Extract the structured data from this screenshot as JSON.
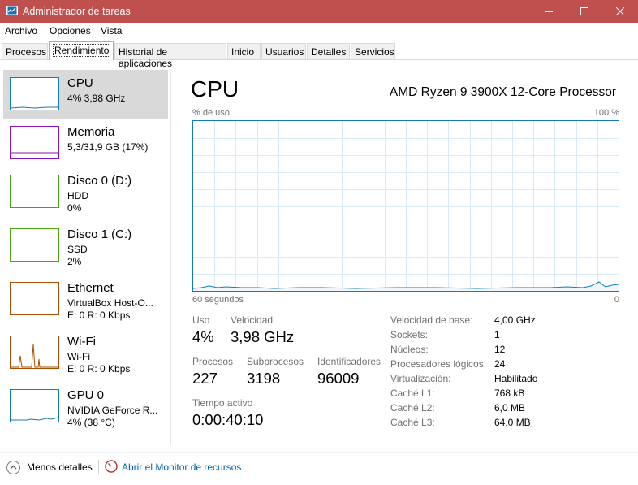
{
  "window": {
    "title": "Administrador de tareas"
  },
  "menu": [
    "Archivo",
    "Opciones",
    "Vista"
  ],
  "tabs": [
    "Procesos",
    "Rendimiento",
    "Historial de aplicaciones",
    "Inicio",
    "Usuarios",
    "Detalles",
    "Servicios"
  ],
  "resources": [
    {
      "name": "CPU",
      "line2": "4% 3,98 GHz",
      "line3": "",
      "color": "#117dbb"
    },
    {
      "name": "Memoria",
      "line2": "5,3/31,9 GB (17%)",
      "line3": "",
      "color": "#8b12ae"
    },
    {
      "name": "Disco 0 (D:)",
      "line2": "HDD",
      "line3": "0%",
      "color": "#4da60c"
    },
    {
      "name": "Disco 1 (C:)",
      "line2": "SSD",
      "line3": "2%",
      "color": "#4da60c"
    },
    {
      "name": "Ethernet",
      "line2": "VirtualBox Host-O...",
      "line3": "E: 0 R: 0 Kbps",
      "color": "#a74f01"
    },
    {
      "name": "Wi-Fi",
      "line2": "Wi-Fi",
      "line3": "E: 0 R: 0 Kbps",
      "color": "#a74f01"
    },
    {
      "name": "GPU 0",
      "line2": "NVIDIA GeForce R...",
      "line3": "4% (38 °C)",
      "color": "#117dbb"
    }
  ],
  "cpu": {
    "title": "CPU",
    "processor": "AMD Ryzen 9 3900X 12-Core Processor",
    "graph_label": "% de uso",
    "graph_max": "100 %",
    "time_label": "60 segundos",
    "time_min": "0",
    "usage_label": "Uso",
    "usage": "4%",
    "speed_label": "Velocidad",
    "speed": "3,98 GHz",
    "processes_label": "Procesos",
    "processes": "227",
    "threads_label": "Subprocesos",
    "threads": "3198",
    "handles_label": "Identificadores",
    "handles": "96009",
    "uptime_label": "Tiempo activo",
    "uptime": "0:00:40:10",
    "details": [
      {
        "label": "Velocidad de base:",
        "value": "4,00 GHz"
      },
      {
        "label": "Sockets:",
        "value": "1"
      },
      {
        "label": "Núcleos:",
        "value": "12"
      },
      {
        "label": "Procesadores lógicos:",
        "value": "24"
      },
      {
        "label": "Virtualización:",
        "value": "Habilitado"
      },
      {
        "label": "Caché L1:",
        "value": "768 kB"
      },
      {
        "label": "Caché L2:",
        "value": "6,0 MB"
      },
      {
        "label": "Caché L3:",
        "value": "64,0 MB"
      }
    ]
  },
  "footer": {
    "fewer_details": "Menos detalles",
    "resource_monitor": "Abrir el Monitor de recursos"
  }
}
